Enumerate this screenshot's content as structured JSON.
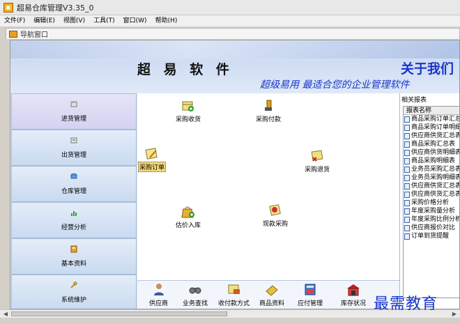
{
  "window": {
    "title": "超易仓库管理V3.35_0"
  },
  "menu": [
    "文件(F)",
    "编辑(E)",
    "视图(V)",
    "工具(T)",
    "窗口(W)",
    "帮助(H)"
  ],
  "nav_window": {
    "title": "导航窗口"
  },
  "banner": {
    "brand": "超 易 软 件",
    "about": "关于我们",
    "slogan": "超级易用 最适合您的企业管理软件"
  },
  "sidebar": [
    {
      "label": "进货管理",
      "active": true
    },
    {
      "label": "出货管理"
    },
    {
      "label": "仓库管理"
    },
    {
      "label": "经营分析"
    },
    {
      "label": "基本资料"
    },
    {
      "label": "系统维护"
    }
  ],
  "flow": {
    "purchase_receive": "采购收货",
    "purchase_pay": "采购付款",
    "purchase_order": "采购订单",
    "purchase_return": "采购退货",
    "estimate_stock_in": "估价入库",
    "cash_purchase": "现款采购"
  },
  "bottom_tools": [
    "供应商",
    "业务查找",
    "收付款方式",
    "商品资料",
    "应付管理",
    "库存状况"
  ],
  "reports": {
    "section_title": "相关报表",
    "column_header": "报表名称",
    "items": [
      "商品采购订单汇总",
      "商品采购订单明细",
      "供应商供货汇总表",
      "商品采购汇总表",
      "供应商供货明细表",
      "商品采购明细表",
      "业务员采购汇总表",
      "业务员采购明细表",
      "供应商供货汇总表",
      "供应商供货汇总表",
      "采购价格分析",
      "年度采购量分析",
      "年度采购比例分析",
      "供应商报价对比",
      "订单到货提醒"
    ]
  },
  "watermark": "最需教育",
  "colors": {
    "accent": "#1a35c8",
    "sidebar": "#d7e4f5",
    "selected_label": "#f4d878"
  }
}
